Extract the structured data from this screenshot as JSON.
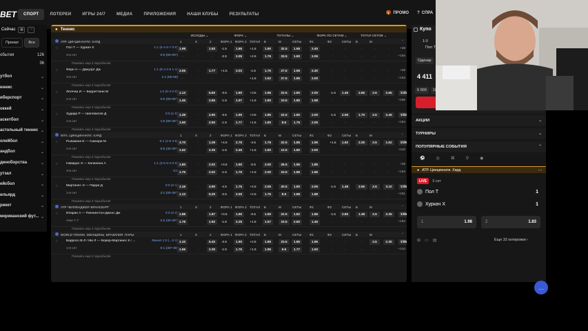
{
  "logo": "BET",
  "nav": [
    "СПОРТ",
    "ЛОТЕРЕИ",
    "ИГРЫ 24/7",
    "МЕДИА",
    "ПРИЛОЖЕНИЯ",
    "НАШИ КЛУБЫ",
    "РЕЗУЛЬТАТЫ"
  ],
  "top_right": {
    "promo": "ПРОМО",
    "help": "СПРА"
  },
  "sidebar": {
    "now": "Сейчас",
    "tabs": [
      "Премат",
      "Все"
    ],
    "events": [
      {
        "label": "обытия",
        "count": "126"
      },
      {
        "label": "",
        "count": "36"
      }
    ],
    "sports": [
      "утбол",
      "еннис",
      "иберспорт",
      "оккей",
      "аскетбол",
      "астольный теннис",
      "олейбол",
      "андбол",
      "диноборства",
      "утзал",
      "ейсбол",
      "ильярд",
      "рикет",
      "мериканский фут..."
    ]
  },
  "main": {
    "category": "Теннис",
    "groups": [
      "ИСХОДЫ",
      "ФОРА",
      "ТОТАЛЫ",
      "ФОРА ПО СЕТАМ",
      "ТОТАЛ СЕТОВ"
    ],
    "cols": [
      "1",
      "X",
      "2",
      "ФОРА 1",
      "ФОРА 2",
      "ТОТАЛ",
      "Б",
      "М",
      "СЕТЫ",
      "Ф1",
      "Ф2",
      "СЕТЫ",
      "Б",
      "М"
    ],
    "hint": "Показать еще 2 подсобытия",
    "leagues": [
      {
        "name": "ATP. ЦИНЦИННАТИ. ХАРД",
        "matches": [
          {
            "name": "Пол Т — Хуркач Х",
            "sub": "3-й сет",
            "score1": "1:1 (6-4 6-7 0-0)",
            "score2": "0:0 (00-00*)",
            "r1": [
              "1.98",
              "-",
              "1.83",
              "-1.5",
              "1.85",
              "+1.5",
              "1.80",
              "32.5",
              "1.55",
              "2.40",
              "-",
              "-",
              "-",
              "-",
              "-",
              "-"
            ],
            "r2": [
              "-",
              "-",
              "-",
              "-2.5",
              "2.05",
              "+2.5",
              "1.75",
              "33.5",
              "1.80",
              "2.05",
              "-",
              "-",
              "-",
              "-",
              "-",
              "-"
            ],
            "plus": [
              "+28",
              "+194"
            ]
          },
          {
            "name": "Ферн А — Джкуорт Дж",
            "sub": "3-й сет",
            "score1": "1:1 (6-4 2-6 1-1)",
            "score2": "1:1 (00-00)",
            "r1": [
              "2.05",
              "-",
              "1.77",
              "+1.5",
              "2.03",
              "-1.5",
              "1.75",
              "27.5",
              "1.55",
              "2.40",
              "-",
              "-",
              "-",
              "-",
              "-",
              "-"
            ],
            "r2": [
              "-",
              "-",
              "-",
              "-",
              "-",
              "+1.5",
              "1.62",
              "27.5",
              "1.85",
              "2.00",
              "-",
              "-",
              "-",
              "-",
              "-",
              "-"
            ],
            "plus": [
              "+28",
              "+194"
            ]
          },
          {
            "name": "Легечка И — Берреттини М",
            "sub": "2-й сет",
            "score1": "1:0 (6-3 0-0)",
            "score2": "0:0 (00-00*)",
            "r1": [
              "1.13",
              "-",
              "5.60",
              "-3.5",
              "1.80",
              "+3.5",
              "1.95",
              "22.5",
              "1.80",
              "2.00",
              "-1.5",
              "1.45",
              "2.65",
              "2.5",
              "2.65",
              "1.43"
            ],
            "r2": [
              "1.45",
              "-",
              "2.65",
              "-1.5",
              "1.97",
              "+1.5",
              "1.80",
              "10.5",
              "1.85",
              "1.58",
              "-",
              "-",
              "-",
              "-",
              "-",
              "-"
            ],
            "plus": [
              "+33",
              "+196"
            ]
          },
          {
            "name": "Хударр Р — Шаповалов Д",
            "sub": "1-й сет",
            "score1": "0:0 (1-0)",
            "score2": "1:0 (00-30*)",
            "r1": [
              "1.38",
              "-",
              "2.90",
              "-3.5",
              "1.90",
              "+3.5",
              "1.85",
              "22.5",
              "1.80",
              "2.00",
              "-1.5",
              "2.06",
              "1.70",
              "2.5",
              "2.45",
              "1.52"
            ],
            "r2": [
              "1.50",
              "-",
              "2.50",
              "-1.5",
              "1.77",
              "+1.5",
              "1.80",
              "8.5",
              "1.75",
              "2.05",
              "-",
              "-",
              "-",
              "-",
              "-",
              "-"
            ],
            "plus": [
              "+28",
              "+184"
            ]
          }
        ]
      },
      {
        "name": "WTA. ЦИНЦИННАТИ. ХАРД",
        "matches": [
          {
            "name": "Рыбакина Е — Саккари М",
            "sub": "2-й сет",
            "score1": "0:1 (2-6 3-5)",
            "score2": "5:5 (40-30*)",
            "r1": [
              "3.70",
              "-",
              "1.29",
              "+4.5",
              "2.75",
              "-4.5",
              "1.75",
              "22.5",
              "1.85",
              "1.95",
              "+1.5",
              "1.62",
              "2.25",
              "2.5",
              "1.62",
              "2.25"
            ],
            "r2": [
              "1.62",
              "-",
              "2.25",
              "-1.5",
              "2.45",
              "+1.5",
              "1.80",
              "12.5",
              "1.80",
              "2.00",
              "-",
              "-",
              "-",
              "-",
              "-",
              "-"
            ],
            "plus": [
              "+34",
              "+110"
            ]
          },
          {
            "name": "Наварро Э — Калинина А",
            "sub": "3-й сет",
            "score1": "1:1 (3-6 6-4 0-0)",
            "score2": "0:0",
            "r1": [
              "1.80",
              "-",
              "2.02",
              "+0.5",
              "1.90",
              "-0.5",
              "2.00",
              "26.5",
              "1.95",
              "1.85",
              "-",
              "-",
              "-",
              "-",
              "-",
              "-"
            ],
            "r2": [
              "1.75",
              "-",
              "2.02",
              "-1.5",
              "1.75",
              "+1.5",
              "2.00",
              "10.5",
              "1.85",
              "1.95",
              "-",
              "-",
              "-",
              "-",
              "-",
              "-"
            ],
            "plus": [
              "+28",
              "+194"
            ]
          },
          {
            "name": "Мартинес Э — Парри Д",
            "sub": "1-й сет",
            "score1": "0:0 (2-1)",
            "score2": "2:1 (00-30*)",
            "r1": [
              "1.16",
              "-",
              "4.90",
              "-4.5",
              "1.75",
              "+4.5",
              "2.05",
              "20.5",
              "1.80",
              "2.05",
              "-1.5",
              "1.48",
              "2.55",
              "2.5",
              "3.10",
              "1.35"
            ],
            "r2": [
              "1.13",
              "-",
              "5.20",
              "-2.5",
              "2.00",
              "+2.5",
              "1.75",
              "8.5",
              "1.88",
              "1.88",
              "-",
              "-",
              "-",
              "-",
              "-",
              "-"
            ],
            "plus": [
              "+42",
              "+191"
            ]
          }
        ]
      },
      {
        "name": "ATP ЧЕЛЛЕНДЖЕР. БРАНСБУРГ",
        "matches": [
          {
            "name": "Иларан А — Пиннингтон-Джонс Дж",
            "sub": "очки 7-7",
            "score1": "0:0 (2-2)",
            "score2": "2:2 (40-40*)",
            "r1": [
              "1.88",
              "-",
              "1.87",
              "+0.5",
              "1.90",
              "-0.5",
              "1.90",
              "22.5",
              "1.82",
              "1.86",
              "-1.5",
              "2.80",
              "1.38",
              "2.5",
              "2.25",
              "1.55"
            ],
            "r2": [
              "1.78",
              "-",
              "1.92",
              "-1.5",
              "2.25",
              "+1.5",
              "1.57",
              "10.5",
              "2.60",
              "1.45",
              "-",
              "-",
              "-",
              "-",
              "-",
              "-"
            ],
            "plus": [
              "+40",
              "+194"
            ]
          }
        ]
      },
      {
        "name": "WORLD TENNIS. ЖЕНЩИНЫ. БРАЗИЛИЯ. ПАРЫ",
        "matches": [
          {
            "name": "Барросо В-Л / Ми Л — Борер-Мартинес К / ...",
            "sub": "1-й сет",
            "score1": "Финал 1:0 (...0-1)",
            "score2": "0:1 (40*-30)",
            "r1": [
              "1.10",
              "-",
              "5.40",
              "-2.5",
              "1.90",
              "+2.5",
              "1.85",
              "23.5",
              "1.85",
              "1.95",
              "-",
              "-",
              "-",
              "2.5",
              "2.30",
              "1.55"
            ],
            "r2": [
              "1.55",
              "-",
              "2.30",
              "-1.5",
              "1.75",
              "+1.5",
              "1.95",
              "9.5",
              "1.77",
              "1.93",
              "-",
              "-",
              "-",
              "-",
              "-",
              "-"
            ],
            "plus": [
              "+33",
              "+144"
            ]
          }
        ]
      }
    ]
  },
  "coupon": {
    "title": "Купо",
    "line1": "1:0",
    "line2": "Пол Т",
    "mode": "Одинар",
    "amount": "4 411",
    "chips": [
      "5 000",
      "10 000",
      "15 000",
      "20 000"
    ],
    "place": "Поставить 4 411"
  },
  "right_sections": {
    "promos": "АКЦИИ",
    "tournaments": "ТУРНИРЫ",
    "popular": "ПОПУЛЯРНЫЕ СОБЫТИЯ"
  },
  "popular": {
    "league": "ATP. Цинциннати. Хард",
    "live": "LIVE",
    "set": "3 сет",
    "p1": "Пол Т",
    "s1": "1",
    "p2": "Хуркач Х",
    "s2": "1",
    "o1_label": "1",
    "o1": "1.98",
    "o2_label": "2",
    "o2": "1.83",
    "more": "Еще 32 котировки"
  }
}
